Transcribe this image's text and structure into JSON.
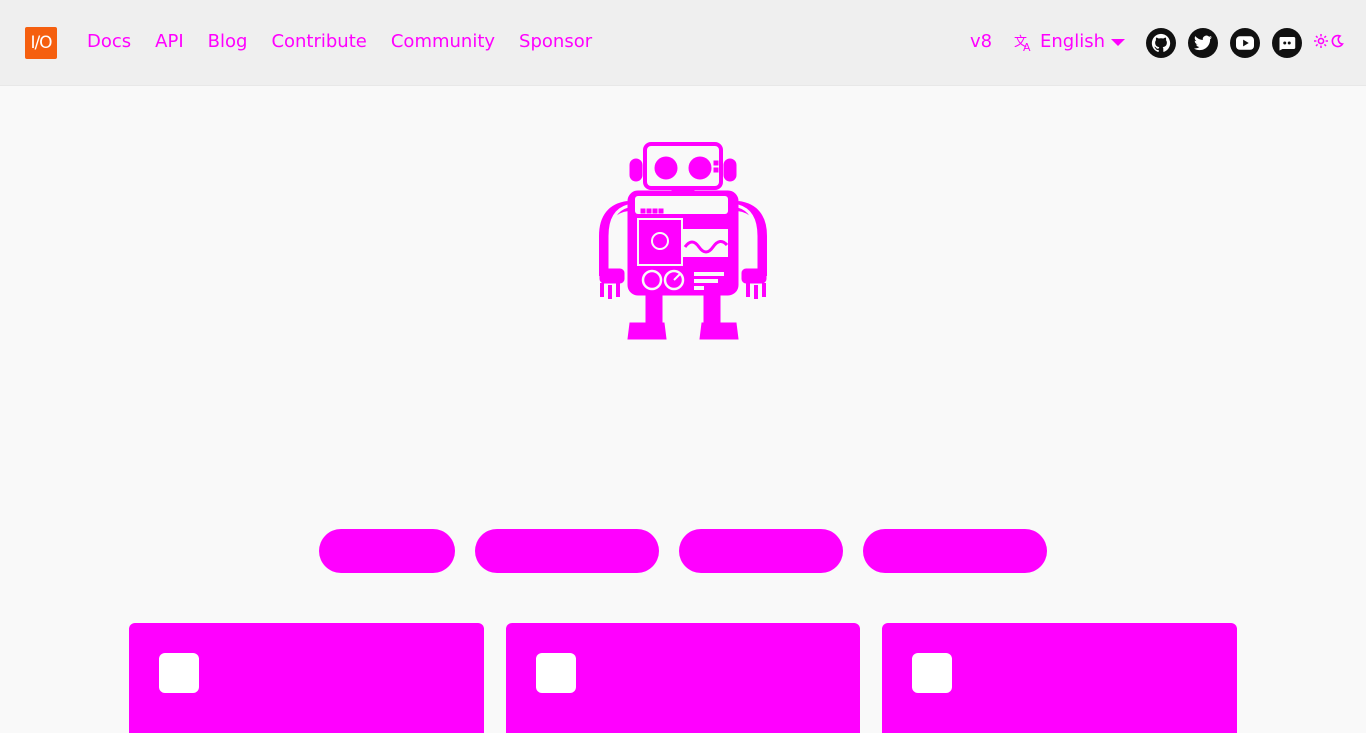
{
  "brand": {
    "logo_text": "I/O"
  },
  "nav": {
    "links": [
      "Docs",
      "API",
      "Blog",
      "Contribute",
      "Community",
      "Sponsor"
    ]
  },
  "header_right": {
    "version": "v8",
    "language": "English",
    "social_icons": [
      "github-icon",
      "twitter-icon",
      "youtube-icon",
      "discord-icon"
    ],
    "theme_icons": [
      "sun-icon",
      "moon-icon"
    ]
  },
  "colors": {
    "accent": "#ff00ff",
    "logo_bg": "#f55f0f",
    "navbar_bg": "#efefef",
    "page_bg": "#f9f9f9",
    "social_bg": "#111111"
  },
  "hero": {
    "illustration": "robot-mascot"
  },
  "pill_buttons": [
    "",
    "",
    "",
    ""
  ],
  "cards": [
    {
      "icon": "card-icon"
    },
    {
      "icon": "card-icon"
    },
    {
      "icon": "card-icon"
    }
  ]
}
